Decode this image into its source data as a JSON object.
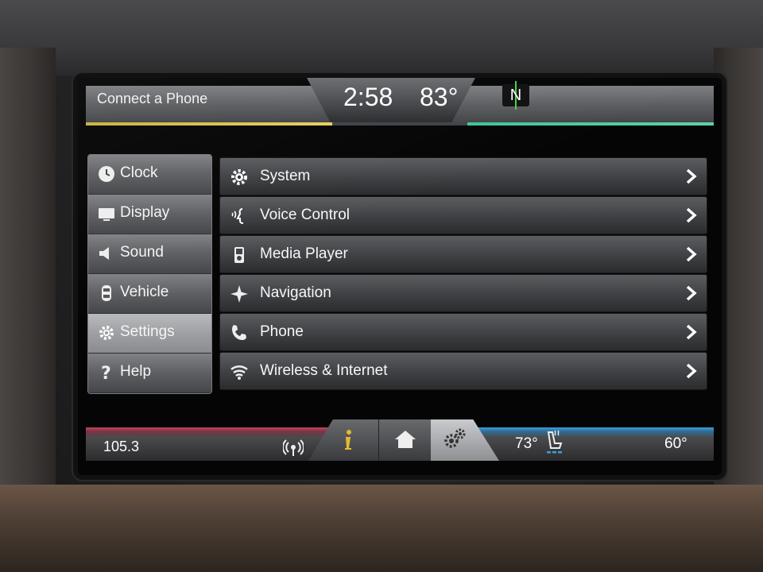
{
  "header": {
    "connect_label": "Connect a Phone",
    "time": "2:58",
    "temperature": "83°",
    "compass": "N"
  },
  "sidebar": {
    "items": [
      {
        "label": "Clock",
        "icon": "clock-icon"
      },
      {
        "label": "Display",
        "icon": "display-icon"
      },
      {
        "label": "Sound",
        "icon": "speaker-icon"
      },
      {
        "label": "Vehicle",
        "icon": "car-icon"
      },
      {
        "label": "Settings",
        "icon": "gear-icon",
        "active": true
      },
      {
        "label": "Help",
        "icon": "question-icon"
      }
    ]
  },
  "settings_list": {
    "items": [
      {
        "label": "System",
        "icon": "gear-icon"
      },
      {
        "label": "Voice Control",
        "icon": "voice-icon"
      },
      {
        "label": "Media Player",
        "icon": "media-player-icon"
      },
      {
        "label": "Navigation",
        "icon": "compass-star-icon"
      },
      {
        "label": "Phone",
        "icon": "phone-icon"
      },
      {
        "label": "Wireless & Internet",
        "icon": "wifi-icon"
      }
    ]
  },
  "bottom_bar": {
    "radio_station": "105.3",
    "climate_temp": "73°",
    "outside_temp": "60°",
    "active_tab": "settings",
    "colors": {
      "audio_accent": "#c0445f",
      "climate_accent": "#3aa0dc",
      "info_icon": "#e5b92e"
    }
  }
}
